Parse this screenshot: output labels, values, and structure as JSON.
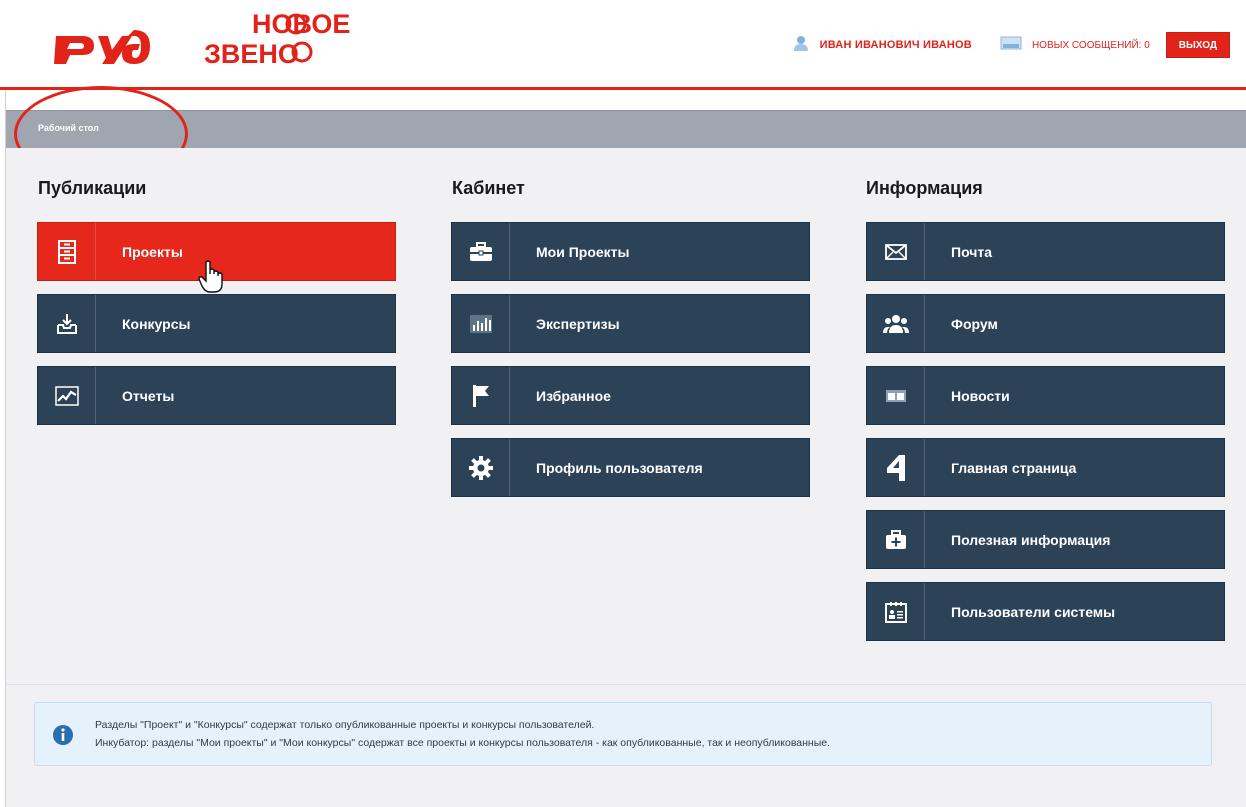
{
  "header": {
    "rzd_logo_text": "РЖД",
    "brand_logo_line1": "НОВОЕ",
    "brand_logo_line2": "ЗВЕНО",
    "user_name": "ИВАН ИВАНОВИЧ ИВАНОВ",
    "messages_label": "НОВЫХ СООБЩЕНИЙ: 0",
    "logout_label": "ВЫХОД",
    "accent_color": "#e2231a"
  },
  "breadcrumb": {
    "current": "Рабочий стол"
  },
  "columns": [
    {
      "title": "Публикации",
      "items": [
        {
          "label": "Проекты",
          "icon": "cabinet-icon",
          "active": true
        },
        {
          "label": "Конкурсы",
          "icon": "inbox-download-icon",
          "active": false
        },
        {
          "label": "Отчеты",
          "icon": "chart-line-icon",
          "active": false
        }
      ]
    },
    {
      "title": "Кабинет",
      "items": [
        {
          "label": "Мои Проекты",
          "icon": "briefcase-icon"
        },
        {
          "label": "Экспертизы",
          "icon": "bar-chart-icon"
        },
        {
          "label": "Избранное",
          "icon": "flag-icon"
        },
        {
          "label": "Профиль пользователя",
          "icon": "gear-icon"
        }
      ]
    },
    {
      "title": "Информация",
      "items": [
        {
          "label": "Почта",
          "icon": "envelope-icon"
        },
        {
          "label": "Форум",
          "icon": "users-icon"
        },
        {
          "label": "Новости",
          "icon": "newspaper-icon"
        },
        {
          "label": "Главная страница",
          "icon": "home-icon"
        },
        {
          "label": "Полезная информация",
          "icon": "first-aid-icon"
        },
        {
          "label": "Пользователи системы",
          "icon": "contact-card-icon"
        }
      ]
    }
  ],
  "info": {
    "line1": "Разделы \"Проект\" и \"Конкурсы\" содержат только опубликованные проекты и конкурсы пользователей.",
    "line2": "Инкубатор: разделы \"Мои проекты\" и \"Мои конкурсы\" содержат все проекты и конкурсы пользователя - как опубликованные, так и неопубликованные."
  }
}
